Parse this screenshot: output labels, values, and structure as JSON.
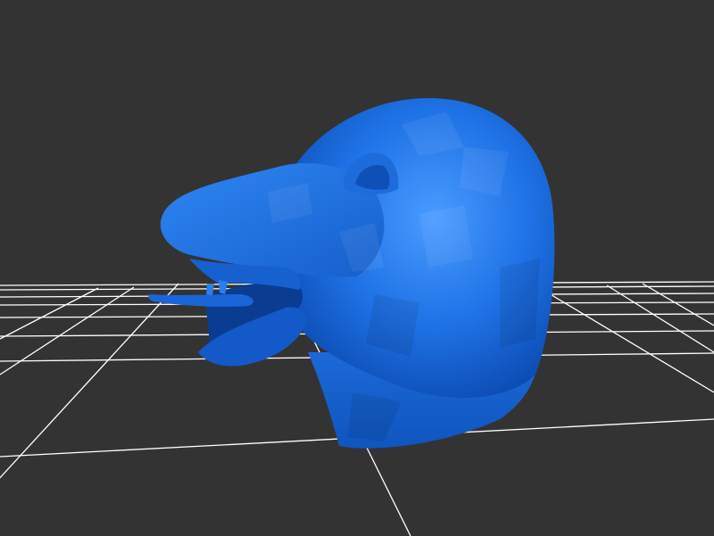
{
  "scene": {
    "background_color": "#333333",
    "grid_color": "#ffffff",
    "model_color": "#1a6be0",
    "model_highlight": "#3a8cf5",
    "model_shadow": "#0d47a8",
    "model_description_icon": "creature-head-model"
  }
}
